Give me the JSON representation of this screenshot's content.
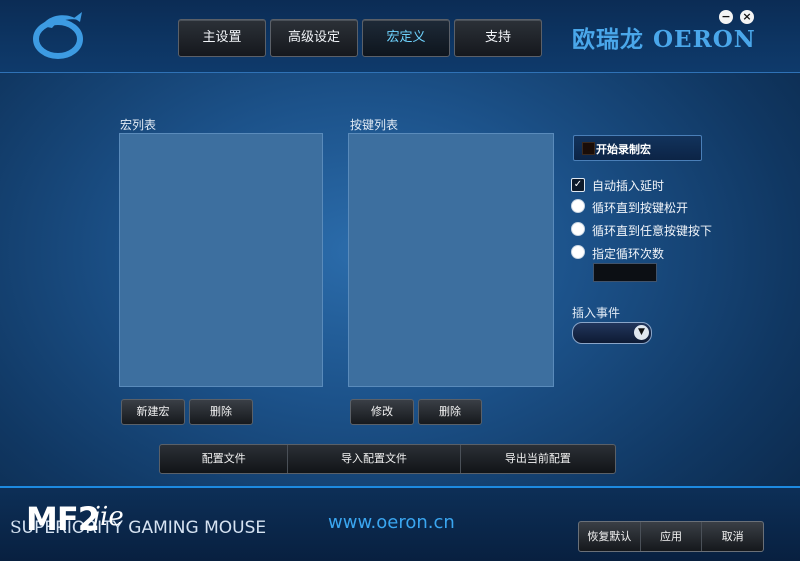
{
  "header": {
    "tabs": [
      {
        "label": "主设置",
        "active": false
      },
      {
        "label": "高级设定",
        "active": false
      },
      {
        "label": "宏定义",
        "active": true
      },
      {
        "label": "支持",
        "active": false
      }
    ],
    "brand": "欧瑞龙 OERON",
    "minimize_label": "−",
    "close_label": "×"
  },
  "macro_panel": {
    "macro_list_label": "宏列表",
    "key_list_label": "按键列表",
    "new_macro_label": "新建宏",
    "delete_macro_label": "删除",
    "modify_label": "修改",
    "delete_key_label": "删除"
  },
  "options": {
    "record_label": "开始录制宏",
    "auto_delay": {
      "label": "自动插入延时",
      "checked": true
    },
    "loop_release": {
      "label": "循环直到按键松开"
    },
    "loop_any_key": {
      "label": "循环直到任意按键按下"
    },
    "loop_count": {
      "label": "指定循环次数",
      "value": ""
    },
    "insert_event_label": "插入事件",
    "insert_event_value": ""
  },
  "config": {
    "profile_label": "配置文件",
    "import_label": "导入配置文件",
    "export_label": "导出当前配置"
  },
  "footer": {
    "model": "MF2",
    "model_script": "jie",
    "slogan_first": "S",
    "slogan": "UPERIORITY GAMING MOUSE",
    "url": "www.oeron.cn",
    "restore_label": "恢复默认",
    "apply_label": "应用",
    "cancel_label": "取消"
  },
  "colors": {
    "accent": "#6fd4ff",
    "brand": "#4aa7ea"
  }
}
